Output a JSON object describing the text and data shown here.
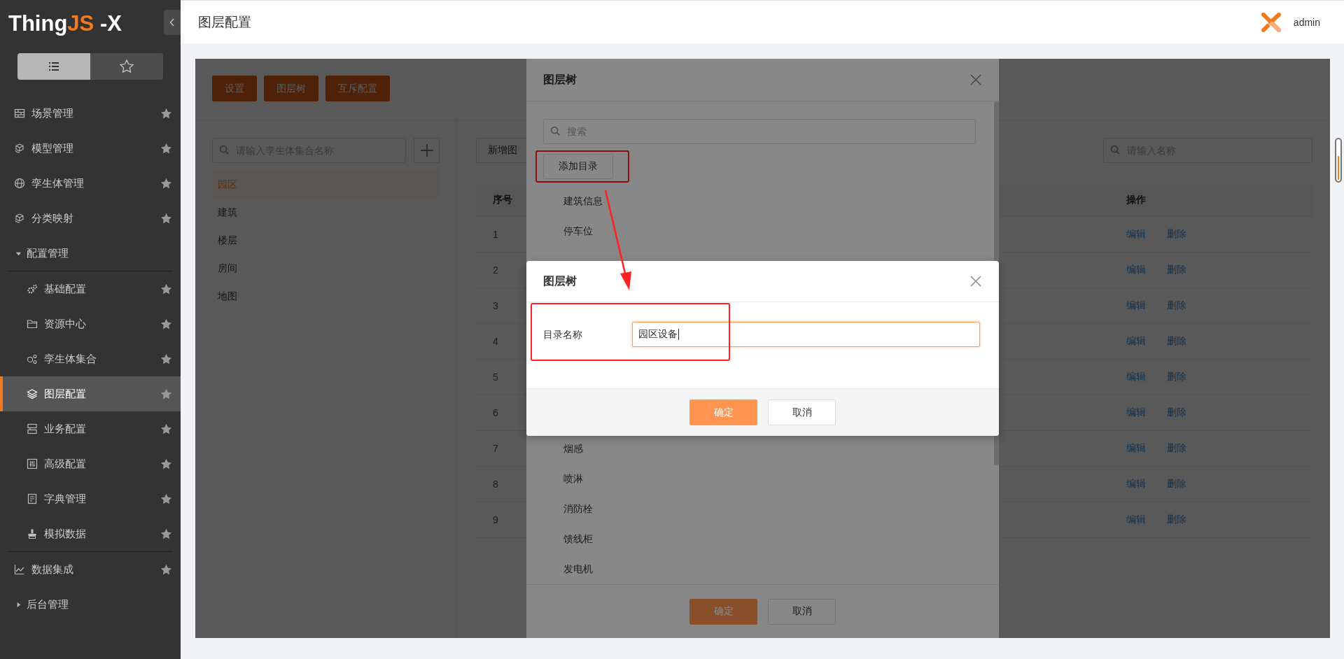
{
  "sidebar": {
    "logo": {
      "text_start": "Thing",
      "text_accent": "JS",
      "text_end": " -X"
    },
    "view_toggle": [
      {
        "kind": "list",
        "selected": true
      },
      {
        "kind": "favorites",
        "selected": false
      }
    ],
    "nav": [
      {
        "kind": "link",
        "label": "场景管理",
        "selected": false
      },
      {
        "kind": "link",
        "label": "模型管理",
        "selected": false
      },
      {
        "kind": "link",
        "label": "孪生体管理",
        "selected": false
      },
      {
        "kind": "link",
        "label": "分类映射",
        "selected": false
      },
      {
        "kind": "group",
        "label": "配置管理",
        "selected": false,
        "expanded": true,
        "children": [
          {
            "kind": "link",
            "label": "基础配置",
            "selected": false
          },
          {
            "kind": "link",
            "label": "资源中心",
            "selected": false
          },
          {
            "kind": "link",
            "label": "孪生体集合",
            "selected": false
          },
          {
            "kind": "link",
            "label": "图层配置",
            "selected": true
          },
          {
            "kind": "link",
            "label": "业务配置",
            "selected": false
          },
          {
            "kind": "link",
            "label": "高级配置",
            "selected": false
          },
          {
            "kind": "link",
            "label": "字典管理",
            "selected": false
          },
          {
            "kind": "link",
            "label": "模拟数据",
            "selected": false
          }
        ]
      },
      {
        "kind": "link",
        "label": "数据集成",
        "selected": false
      },
      {
        "kind": "group",
        "label": "后台管理",
        "selected": false,
        "expanded": false
      }
    ]
  },
  "header": {
    "title": "图层配置",
    "user": "admin"
  },
  "toolbar": [
    "设置",
    "图层树",
    "互斥配置"
  ],
  "collections": {
    "search_placeholder": "请输入孪生体集合名称",
    "items": [
      {
        "label": "园区",
        "selected": true
      },
      {
        "label": "建筑",
        "selected": false
      },
      {
        "label": "楼层",
        "selected": false
      },
      {
        "label": "房间",
        "selected": false
      },
      {
        "label": "地图",
        "selected": false
      }
    ]
  },
  "layers": {
    "add_button": "新增图",
    "search_placeholder": "请输入名称",
    "columns": [
      "序号",
      "操作"
    ],
    "rows": [
      {
        "index": "1",
        "actions": [
          "编辑",
          "删除"
        ]
      },
      {
        "index": "2",
        "actions": [
          "编辑",
          "删除"
        ]
      },
      {
        "index": "3",
        "actions": [
          "编辑",
          "删除"
        ]
      },
      {
        "index": "4",
        "actions": [
          "编辑",
          "删除"
        ]
      },
      {
        "index": "5",
        "actions": [
          "编辑",
          "删除"
        ]
      },
      {
        "index": "6",
        "actions": [
          "编辑",
          "删除"
        ]
      },
      {
        "index": "7",
        "actions": [
          "编辑",
          "删除"
        ]
      },
      {
        "index": "8",
        "actions": [
          "编辑",
          "删除"
        ]
      },
      {
        "index": "9",
        "actions": [
          "编辑",
          "删除"
        ]
      }
    ]
  },
  "tree_dialog": {
    "title": "图层树",
    "search_placeholder": "搜索",
    "add_button": {
      "label": "添加目录",
      "highlighted": true
    },
    "items_above": [
      "建筑信息",
      "停车位"
    ],
    "items_below": [
      "烟感",
      "喷淋",
      "消防栓",
      "馈线柜",
      "发电机"
    ],
    "buttons": [
      {
        "label": "确定",
        "kind": "primary"
      },
      {
        "label": "取消",
        "kind": "default"
      }
    ]
  },
  "folder_dialog": {
    "title": "图层树",
    "field_label": "目录名称",
    "field_value": "园区设备",
    "focused": true,
    "highlighted": true,
    "buttons": [
      {
        "label": "确定",
        "kind": "primary"
      },
      {
        "label": "取消",
        "kind": "default"
      }
    ]
  },
  "annotation": {
    "arrow": true
  }
}
